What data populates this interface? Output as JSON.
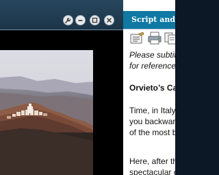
{
  "window": {
    "controls": [
      "wrench-icon",
      "minimize-icon",
      "maximize-icon",
      "close-icon"
    ]
  },
  "panel": {
    "title": "Script and In",
    "toolbar": [
      "notes-icon",
      "print-icon",
      "copy-icon"
    ],
    "notice_line1": "Please subtitl",
    "notice_line2": "for reference.",
    "heading": "Orvieto’s Cath",
    "para1": [
      "Time, in Italy,",
      "you backward",
      "of the most b"
    ],
    "para2": [
      "Here, after th",
      "spectacular c"
    ]
  },
  "colors": {
    "panel_header": "#0f79a3",
    "titlebar": "#1f3c52",
    "video_bg": "#000000"
  }
}
